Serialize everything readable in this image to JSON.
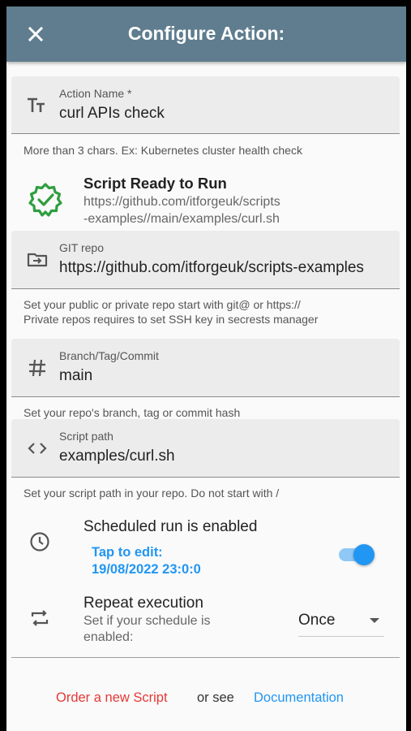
{
  "appbar": {
    "title": "Configure Action:",
    "close_icon": "close-icon"
  },
  "action_name": {
    "label": "Action Name *",
    "value": "curl APIs check",
    "icon": "text-format-icon",
    "helper": "More than 3 chars. Ex: Kubernetes cluster health check"
  },
  "script_status": {
    "title": "Script Ready to Run",
    "url_line1": "https://github.com/itforgeuk/scripts",
    "url_line2": "-examples//main/examples/curl.sh",
    "icon": "verified-badge-icon",
    "accent": "#2e9e3e"
  },
  "git_repo": {
    "label": "GIT repo",
    "value": "https://github.com/itforgeuk/scripts-examples",
    "icon": "folder-arrow-icon",
    "helper_line1": "Set your public or private repo start with git@ or https://",
    "helper_line2": "Private repos requires to set SSH key in secrests manager"
  },
  "branch": {
    "label": "Branch/Tag/Commit",
    "value": "main",
    "icon": "hash-icon",
    "helper": "Set your repo's  branch, tag or commit hash"
  },
  "script_path": {
    "label": "Script path",
    "value": "examples/curl.sh",
    "icon": "code-icon",
    "helper": "Set your script path in your repo. Do not start with /"
  },
  "schedule": {
    "title": "Scheduled run is enabled",
    "tap_label": "Tap to edit:",
    "datetime": "19/08/2022 23:0:0",
    "enabled": true,
    "icon": "clock-icon"
  },
  "repeat": {
    "title": "Repeat execution",
    "subtitle_line1": "Set if your schedule is",
    "subtitle_line2": "enabled:",
    "selected": "Once",
    "icon": "repeat-icon"
  },
  "footer": {
    "order_link": "Order a new Script",
    "or_see": "or see",
    "docs_link": "Documentation"
  },
  "colors": {
    "appbar": "#5f7d8e",
    "link_blue": "#2196f3",
    "link_red": "#e53935"
  }
}
